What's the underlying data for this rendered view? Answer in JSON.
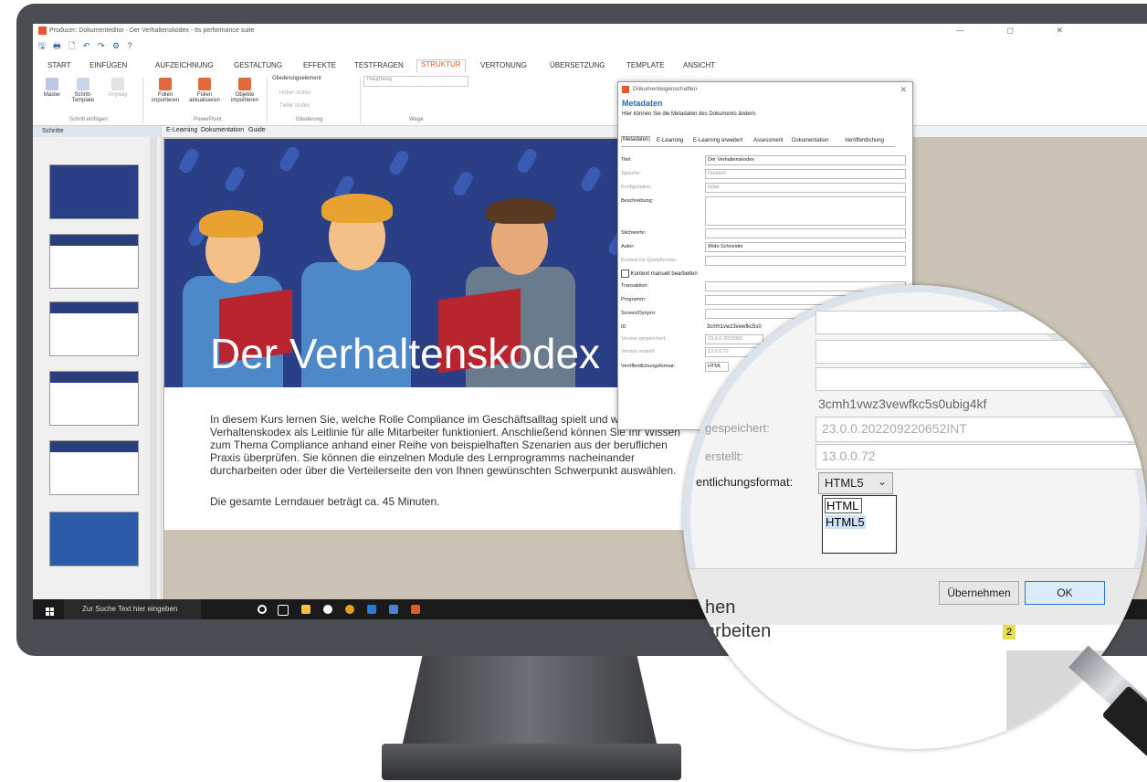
{
  "app": {
    "title": "Producer: Dokumenteditor - Der Verhaltenskodex - tts performance suite",
    "window_controls": "— ◻ ✕",
    "quick_access": "🖫 🖶 🗋 ↶ ↷ ⚙ ?"
  },
  "ribbon_tabs": [
    "START",
    "EINFÜGEN",
    "AUFZEICHNUNG",
    "GESTALTUNG",
    "EFFEKTE",
    "TESTFRAGEN",
    "STRUKTUR",
    "VERTONUNG",
    "ÜBERSETZUNG",
    "TEMPLATE",
    "ANSICHT"
  ],
  "ribbon": {
    "master": "Master",
    "schritt_template": "Schritt-Template",
    "anyway": "Anyway",
    "group1": "Schritt einfügen",
    "folien_importieren": "Folien importieren",
    "folien_aktualisieren": "Folien aktualisieren",
    "objekte_importieren": "Objekte importieren",
    "group2": "PowerPoint",
    "gliederungselement": "Gliederungselement",
    "hoeher_stufen": "Höher stufen",
    "tiefer_stufen": "Tiefer stufen",
    "group3": "Gliederung",
    "hauptweg": "Hauptweg",
    "group4": "Wege"
  },
  "side_panel": {
    "title": "Schritte"
  },
  "doc_tabs": [
    "E-Learning",
    "Dokumentation",
    "Guide"
  ],
  "slide": {
    "title": "Der Verhaltenskodex",
    "body": "In diesem Kurs lernen Sie, welche Rolle Compliance im Geschäftsalltag spielt und wie der Verhaltenskodex als Leitlinie für alle Mitarbeiter funktioniert. Anschließend können Sie Ihr Wissen zum Thema Compliance anhand einer Reihe von beispielhaften Szenarien aus der beruflichen Praxis überprüfen. Sie können die einzelnen Module des Lernprogramms nacheinander durcharbeiten oder über die Verteilerseite den von Ihnen gewünschten Schwerpunkt auswählen.",
    "duration": "Die gesamte Lerndauer beträgt ca. 45 Minuten."
  },
  "taskbar": {
    "search_placeholder": "Zur Suche Text hier eingeben"
  },
  "dialog": {
    "title": "Dokumenteigenschaften",
    "heading": "Metadaten",
    "subtitle": "Hier können Sie die Metadaten des Dokuments ändern.",
    "tabs": [
      "Metadaten",
      "E-Learning",
      "E-Learning erweitert",
      "Assessment",
      "Dokumentation",
      "Veröffentlichung"
    ],
    "fields": {
      "titel_label": "Titel:",
      "titel_value": "Der Verhaltenskodex",
      "sprache_label": "Sprache:",
      "sprache_value": "Deutsch",
      "konfig_label": "Konfiguration:",
      "konfig_value": "initial",
      "beschreibung_label": "Beschreibung:",
      "stichworte_label": "Stichworte:",
      "autor_label": "Autor:",
      "autor_value": "Wido Schneider",
      "kontext_label": "Kontext für QuickAccess:",
      "kontext_checkbox": "Kontext manuell bearbeiten",
      "transaktion_label": "Transaktion:",
      "programm_label": "Programm:",
      "screen_label": "Screen/Dynpro:",
      "id_label": "ID",
      "id_value": "3cmh1vwz3vewfkc5s0",
      "version_gesp_label": "Version gespeichert:",
      "version_gesp_value": "23.0.0.2022092",
      "version_erst_label": "Version erstellt:",
      "version_erst_value": "13.0.0.72",
      "format_label": "Veröffentlichungsformat:",
      "format_value": "HTML"
    }
  },
  "magnifier": {
    "id_value": "3cmh1vwz3vewfkc5s0ubig4kf",
    "gespeichert_label": "gespeichert:",
    "gespeichert_value": "23.0.0.202209220652INT",
    "erstellt_label": "erstellt:",
    "erstellt_value": "13.0.0.72",
    "format_label": "entlichungsformat:",
    "format_selected": "HTML5",
    "options": [
      "HTML",
      "HTML5"
    ],
    "apply_button": "Übernehmen",
    "ok_button": "OK",
    "bg_text1": "hen",
    "bg_text2": "arbeiten",
    "page_badge": "2"
  }
}
